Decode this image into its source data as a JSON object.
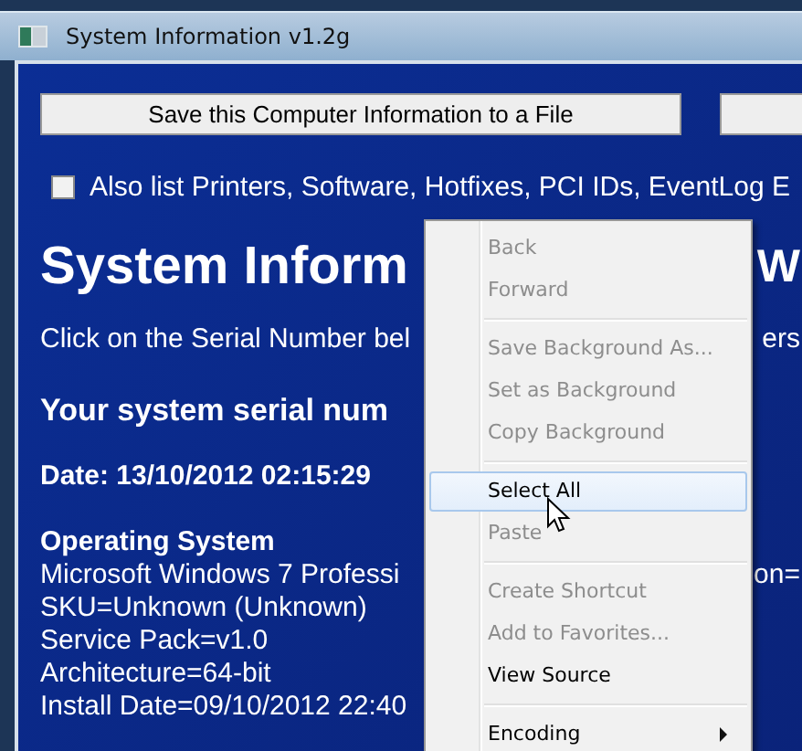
{
  "window": {
    "title": "System Information v1.2g"
  },
  "buttons": [
    {
      "label": "Save this Computer Information to a File"
    }
  ],
  "checkbox": {
    "label": "Also list Printers, Software, Hotfixes, PCI IDs, EventLog E",
    "checked": false
  },
  "content": [
    {
      "kind": "title",
      "text": "System Inform",
      "tail": "W"
    },
    {
      "kind": "text",
      "text": "Click on the Serial Number bel",
      "tail": "ers"
    },
    {
      "kind": "subheading",
      "text": "Your system serial num"
    },
    {
      "kind": "date",
      "text": "Date: 13/10/2012 02:15:29"
    },
    {
      "kind": "heading",
      "text": "Operating System"
    },
    {
      "kind": "line",
      "text": "Microsoft Windows 7 Professi",
      "tail": "on="
    },
    {
      "kind": "line",
      "text": "SKU=Unknown (Unknown)"
    },
    {
      "kind": "line",
      "text": "Service Pack=v1.0"
    },
    {
      "kind": "line",
      "text": "Architecture=64-bit"
    },
    {
      "kind": "line",
      "text": "Install Date=09/10/2012 22:40"
    }
  ],
  "context_menu": {
    "items": [
      {
        "kind": "item",
        "label": "Back",
        "disabled": true,
        "selected": false
      },
      {
        "kind": "item",
        "label": "Forward",
        "disabled": true,
        "selected": false
      },
      {
        "kind": "separator"
      },
      {
        "kind": "item",
        "label": "Save Background As...",
        "disabled": true,
        "selected": false
      },
      {
        "kind": "item",
        "label": "Set as Background",
        "disabled": true,
        "selected": false
      },
      {
        "kind": "item",
        "label": "Copy Background",
        "disabled": true,
        "selected": false
      },
      {
        "kind": "separator"
      },
      {
        "kind": "item",
        "label": "Select All",
        "disabled": false,
        "selected": true
      },
      {
        "kind": "item",
        "label": "Paste",
        "disabled": true,
        "selected": false
      },
      {
        "kind": "separator"
      },
      {
        "kind": "item",
        "label": "Create Shortcut",
        "disabled": true,
        "selected": false
      },
      {
        "kind": "item",
        "label": "Add to Favorites...",
        "disabled": true,
        "selected": false
      },
      {
        "kind": "item",
        "label": "View Source",
        "disabled": false,
        "selected": false
      },
      {
        "kind": "separator"
      },
      {
        "kind": "item",
        "label": "Encoding",
        "disabled": false,
        "selected": false,
        "submenu": true
      }
    ]
  }
}
